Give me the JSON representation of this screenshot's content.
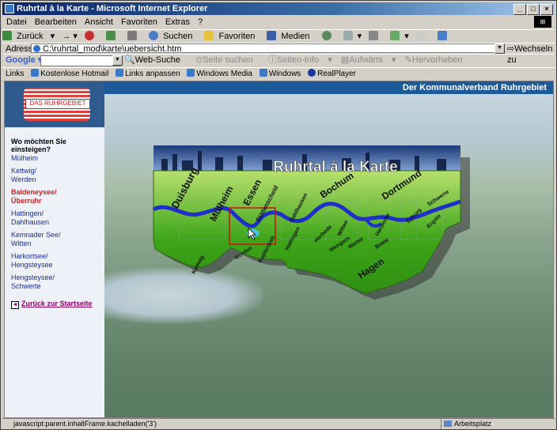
{
  "window": {
    "title": "Ruhrtal à la Karte - Microsoft Internet Explorer",
    "controls": [
      "_",
      "□",
      "×"
    ]
  },
  "menu": [
    "Datei",
    "Bearbeiten",
    "Ansicht",
    "Favoriten",
    "Extras",
    "?"
  ],
  "toolbar": {
    "back": "Zurück",
    "search": "Suchen",
    "favorites": "Favoriten",
    "media": "Medien"
  },
  "address": {
    "label": "Adresse",
    "value": "C:\\ruhrtal_mod\\karte\\uebersicht.htm",
    "go": "Wechseln zu"
  },
  "google": {
    "label": "Google",
    "web_search": "Web-Suche",
    "site_search": "Seite suchen",
    "page_info": "Seiten-Info",
    "up": "Aufwärts",
    "highlight": "Hervorheben"
  },
  "links": {
    "label": "Links",
    "items": [
      "Kostenlose Hotmail",
      "Links anpassen",
      "Windows Media",
      "Windows",
      "RealPlayer"
    ]
  },
  "site": {
    "logo_text": "DAS RUHRGEBIET",
    "header": "Der Kommunalverband Ruhrgebiet",
    "nav_title": "Wo möchten Sie einsteigen?",
    "nav": [
      {
        "l1": "Mülheim",
        "l2": ""
      },
      {
        "l1": "Kettwig/",
        "l2": "Werden"
      },
      {
        "l1": "Baldeneysee/",
        "l2": "Überruhr"
      },
      {
        "l1": "Hattingen/",
        "l2": "Dahlhausen"
      },
      {
        "l1": "Kemnader See/",
        "l2": "Witten"
      },
      {
        "l1": "Harkortsee/",
        "l2": "Hengsteysee"
      },
      {
        "l1": "Hengsteysee/",
        "l2": "Schwerte"
      }
    ],
    "back": "Zurück zur Startseite"
  },
  "map": {
    "title": "Ruhrtal à la Karte",
    "labels": [
      "Duisburg",
      "Mülheim",
      "Essen",
      "Rüttenscheid",
      "Bochum",
      "Dahlhausen",
      "Hattingen",
      "Dortmund",
      "Herdecke",
      "Syburg",
      "Schwerte",
      "Ergste",
      "Kettwig",
      "Werden",
      "Kupferdreh",
      "Herbede",
      "Witten",
      "Wengern",
      "Wetter",
      "Boele",
      "Hagen"
    ]
  },
  "status": {
    "text": "javascript:parent.inhaltFrame.kachelladen('3')",
    "zone": "Arbeitsplatz"
  },
  "colors": {
    "header": "#1d5a9a",
    "map_green": "#3fa61a",
    "river": "#1f2fc8"
  }
}
